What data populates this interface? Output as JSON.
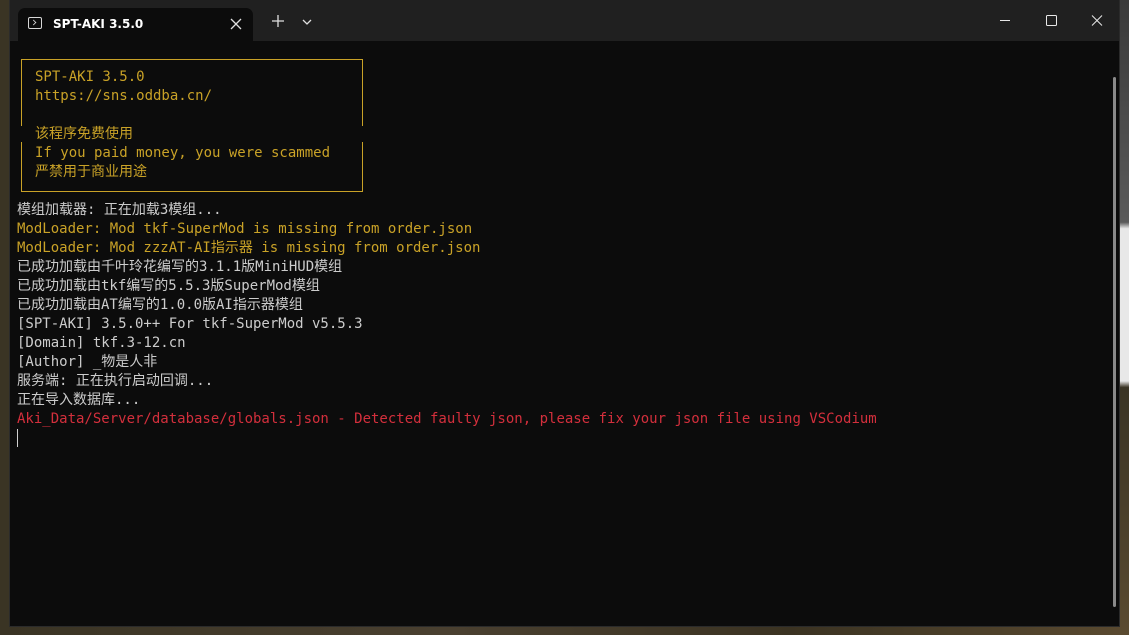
{
  "window": {
    "tab_title": "SPT-AKI 3.5.0",
    "icons": {
      "tab": "terminal-icon",
      "close_tab": "close-icon",
      "new_tab": "plus-icon",
      "dropdown": "chevron-down-icon",
      "minimize": "minimize-icon",
      "maximize": "maximize-icon",
      "close": "close-icon"
    }
  },
  "colors": {
    "warning": "#c9a227",
    "error": "#d32f3c",
    "text": "#cccccc",
    "background": "#0c0c0c",
    "titlebar": "#202020"
  },
  "console": {
    "banner": {
      "line1": "SPT-AKI 3.5.0",
      "line2": "https://sns.oddba.cn/",
      "line3": "该程序免费使用",
      "line4": "If you paid money, you were scammed",
      "line5": "严禁用于商业用途"
    },
    "lines": [
      "模组加载器: 正在加载3模组...",
      "ModLoader: Mod tkf-SuperMod is missing from order.json",
      "ModLoader: Mod zzzAT-AI指示器 is missing from order.json",
      "已成功加载由千叶玲花编写的3.1.1版MiniHUD模组",
      "已成功加载由tkf编写的5.5.3版SuperMod模组",
      "已成功加载由AT编写的1.0.0版AI指示器模组",
      "[SPT-AKI] 3.5.0++ For tkf-SuperMod v5.5.3",
      "[Domain] tkf.3-12.cn",
      "[Author] _物是人非",
      "服务端: 正在执行启动回调...",
      "正在导入数据库...",
      "Aki_Data/Server/database/globals.json - Detected faulty json, please fix your json file using VSCodium"
    ]
  }
}
